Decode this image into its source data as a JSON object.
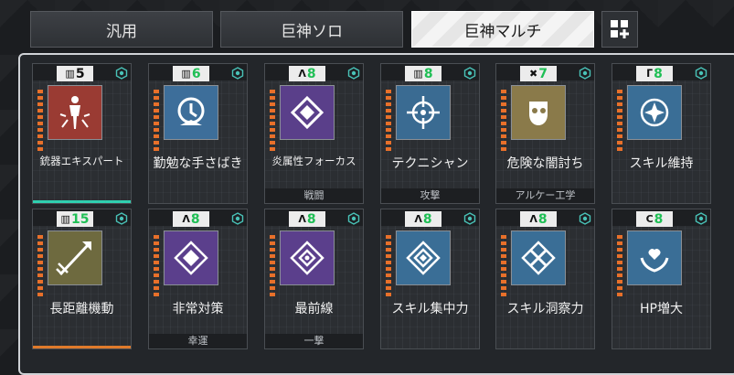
{
  "tabs": [
    {
      "label": "汎用"
    },
    {
      "label": "巨神ソロ"
    },
    {
      "label": "巨神マルチ",
      "active": true
    }
  ],
  "grid_button": {
    "icon": "grid-add-icon"
  },
  "cards": [
    {
      "label": "銃器エキスパート",
      "level": "5",
      "badge_icon": "m-icon",
      "color": "#9a3b33",
      "category": "",
      "accent": "teal"
    },
    {
      "label": "勤勉な手さばき",
      "level": "6",
      "badge_icon": "m-icon",
      "color": "#3d6e9a",
      "category": ""
    },
    {
      "label": "炎属性フォーカス",
      "level": "8",
      "badge_icon": "a-icon",
      "color": "#5a3f8a",
      "category": "戦闘"
    },
    {
      "label": "テクニシャン",
      "level": "8",
      "badge_icon": "m-icon",
      "color": "#3a6b92",
      "category": "攻撃"
    },
    {
      "label": "危険な闇討ち",
      "level": "7",
      "badge_icon": "x-icon",
      "color": "#8a7a4a",
      "category": "アルケー工学"
    },
    {
      "label": "スキル維持",
      "level": "8",
      "badge_icon": "r-icon",
      "color": "#3a6e96",
      "category": ""
    },
    {
      "label": "長距離機動",
      "level": "15",
      "badge_icon": "m-icon",
      "color": "#6e6a3f",
      "category": "",
      "accent": "orange"
    },
    {
      "label": "非常対策",
      "level": "8",
      "badge_icon": "a-icon",
      "color": "#5b3f8c",
      "category": "幸運"
    },
    {
      "label": "最前線",
      "level": "8",
      "badge_icon": "a-icon",
      "color": "#5b3f8c",
      "category": "一撃"
    },
    {
      "label": "スキル集中力",
      "level": "8",
      "badge_icon": "a-icon",
      "color": "#3a6e96",
      "category": ""
    },
    {
      "label": "スキル洞察力",
      "level": "8",
      "badge_icon": "a-icon",
      "color": "#3a6e96",
      "category": ""
    },
    {
      "label": "HP増大",
      "level": "8",
      "badge_icon": "c-icon",
      "color": "#3a6e96",
      "category": ""
    }
  ]
}
